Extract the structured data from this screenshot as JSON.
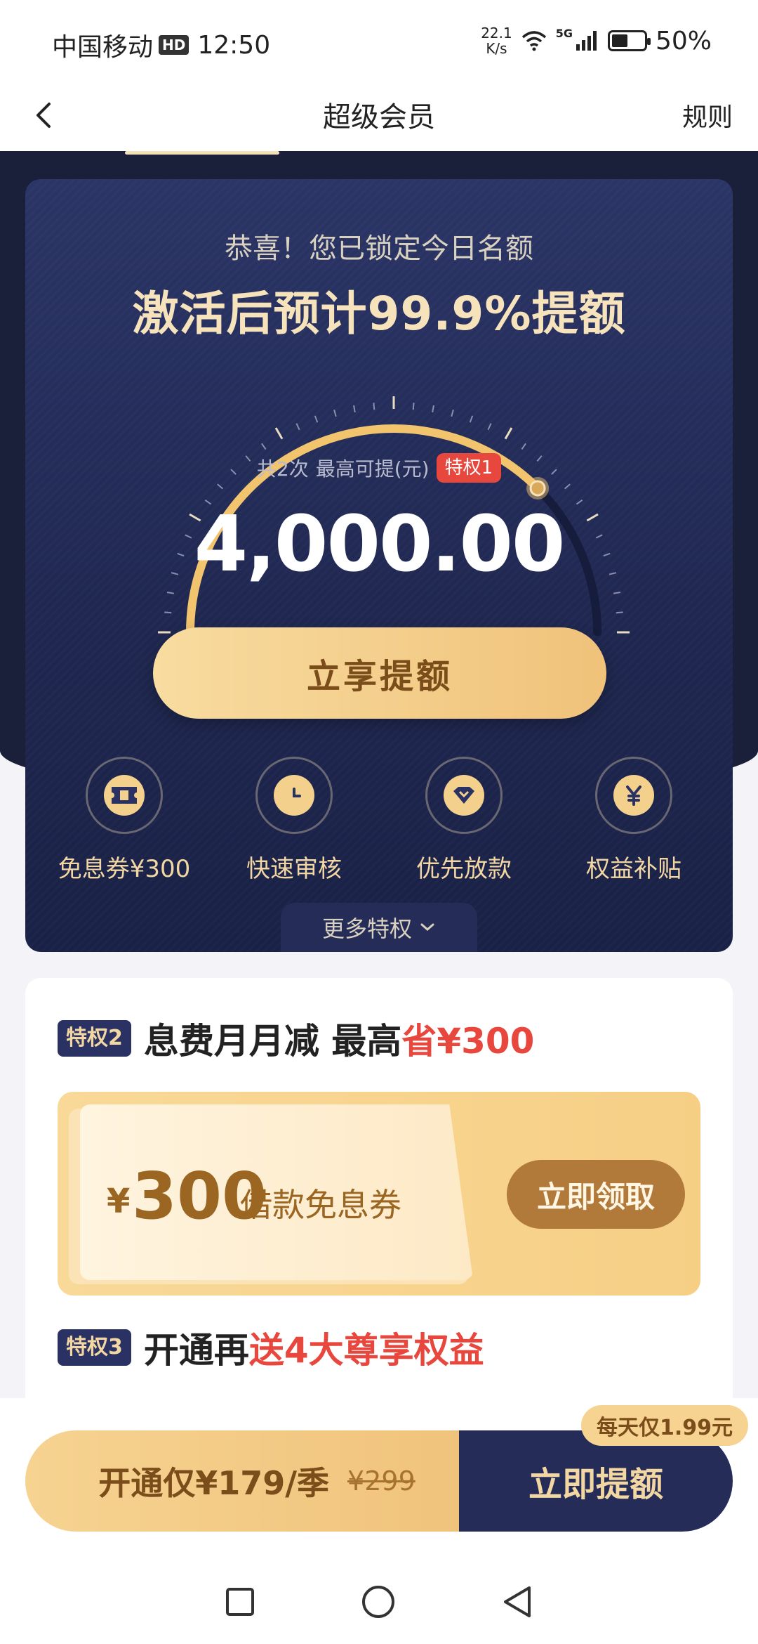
{
  "status_bar": {
    "carrier": "中国移动",
    "hd": "HD",
    "time": "12:50",
    "net_speed_value": "22.1",
    "net_speed_unit": "K/s",
    "net_type": "5G",
    "battery": "50%"
  },
  "nav": {
    "title": "超级会员",
    "rules": "规则"
  },
  "hero": {
    "congrats": "恭喜！您已锁定今日名额",
    "headline": "激活后预计99.9%提额",
    "times_label": "共2次",
    "max_label": "最高可提(元)",
    "privilege_badge": "特权1",
    "amount": "4,000.00",
    "gauge_progress": 0.75,
    "cta": "立享提额",
    "perks": [
      {
        "label": "免息券¥300",
        "icon": "ticket-icon"
      },
      {
        "label": "快速审核",
        "icon": "clock-icon"
      },
      {
        "label": "优先放款",
        "icon": "diamond-icon"
      },
      {
        "label": "权益补贴",
        "icon": "yen-icon"
      }
    ],
    "more": "更多特权"
  },
  "privilege2": {
    "badge": "特权2",
    "title_main": "息费月月减 最高",
    "title_highlight": "省¥300",
    "coupon": {
      "currency": "¥",
      "value": "300",
      "text": "借款免息券",
      "button": "立即领取"
    }
  },
  "privilege3": {
    "badge": "特权3",
    "title_main": "开通再",
    "title_highlight": "送4大尊享权益"
  },
  "buy_bar": {
    "daily_tag": "每天仅1.99元",
    "price_text": "开通仅¥179/季",
    "original_price": "¥299",
    "cta": "立即提额"
  },
  "colors": {
    "navy": "#1f2750",
    "gold": "#f0c27a",
    "accent_red": "#e8473e",
    "brown": "#7b4d1a"
  }
}
